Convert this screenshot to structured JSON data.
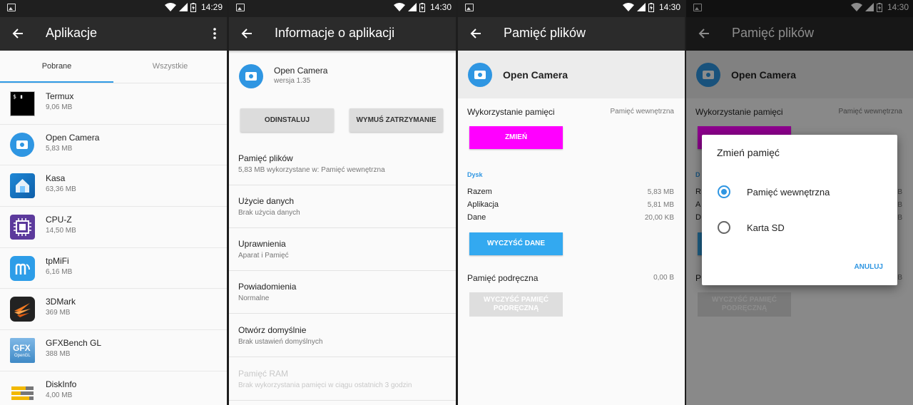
{
  "screens": [
    {
      "status": {
        "time": "14:29"
      },
      "title": "Aplikacje",
      "tabs": [
        {
          "label": "Pobrane"
        },
        {
          "label": "Wszystkie"
        }
      ],
      "apps": [
        {
          "name": "Termux",
          "size": "9,06 MB",
          "icon": "termux-icon"
        },
        {
          "name": "Open Camera",
          "size": "5,83 MB",
          "icon": "camera-icon"
        },
        {
          "name": "Kasa",
          "size": "63,36 MB",
          "icon": "kasa-icon"
        },
        {
          "name": "CPU-Z",
          "size": "14,50 MB",
          "icon": "cpu-icon"
        },
        {
          "name": "tpMiFi",
          "size": "6,16 MB",
          "icon": "tpmifi-icon"
        },
        {
          "name": "3DMark",
          "size": "369 MB",
          "icon": "3dmark-icon"
        },
        {
          "name": "GFXBench GL",
          "size": "388 MB",
          "icon": "gfxbench-icon"
        },
        {
          "name": "DiskInfo",
          "size": "4,00 MB",
          "icon": "diskinfo-icon"
        }
      ]
    },
    {
      "status": {
        "time": "14:30"
      },
      "title": "Informacje o aplikacji",
      "app_name": "Open Camera",
      "app_version": "wersja 1.35",
      "buttons": {
        "uninstall": "ODINSTALUJ",
        "force_stop": "WYMUŚ ZATRZYMANIE"
      },
      "rows": [
        {
          "title": "Pamięć plików",
          "sub": "5,83 MB wykorzystane w: Pamięć wewnętrzna"
        },
        {
          "title": "Użycie danych",
          "sub": "Brak użycia danych"
        },
        {
          "title": "Uprawnienia",
          "sub": "Aparat i Pamięć"
        },
        {
          "title": "Powiadomienia",
          "sub": "Normalne"
        },
        {
          "title": "Otwórz domyślnie",
          "sub": "Brak ustawień domyślnych"
        },
        {
          "title": "Pamięć RAM",
          "sub": "Brak wykorzystania pamięci w ciągu ostatnich 3 godzin"
        }
      ]
    },
    {
      "status": {
        "time": "14:30"
      },
      "title": "Pamięć plików",
      "app_name": "Open Camera",
      "storage_used_label": "Wykorzystanie pamięci",
      "storage_used_value": "Pamięć wewnętrzna",
      "change_button": "ZMIEŃ",
      "disk_section": "Dysk",
      "total_label": "Razem",
      "total_value": "5,83 MB",
      "app_label": "Aplikacja",
      "app_value": "5,81 MB",
      "data_label": "Dane",
      "data_value": "20,00 KB",
      "clear_data_button": "WYCZYŚĆ DANE",
      "cache_label": "Pamięć podręczna",
      "cache_value": "0,00 B",
      "clear_cache_button_l1": "WYCZYŚĆ PAMIĘĆ",
      "clear_cache_button_l2": "PODRĘCZNĄ",
      "colors": {
        "change_button": "#ff00ff",
        "clear_data_button": "#33a9f0",
        "accent": "#2f96e2"
      }
    },
    {
      "status": {
        "time": "14:30"
      },
      "title": "Pamięć plików",
      "app_name": "Open Camera",
      "storage_used_label": "Wykorzystanie pamięci",
      "storage_used_value": "Pamięć wewnętrzna",
      "bg_section_letter": "D",
      "bg_row_letters": [
        "R",
        "A",
        "D"
      ],
      "bg_value_suffix": "B",
      "bg_cache_letter": "P",
      "clear_cache_button_l1": "WYCZYŚĆ PAMIĘĆ",
      "clear_cache_button_l2": "PODRĘCZNĄ",
      "dialog": {
        "title": "Zmień pamięć",
        "options": [
          {
            "label": "Pamięć wewnętrzna",
            "selected": true
          },
          {
            "label": "Karta SD",
            "selected": false
          }
        ],
        "cancel": "ANULUJ"
      }
    }
  ]
}
